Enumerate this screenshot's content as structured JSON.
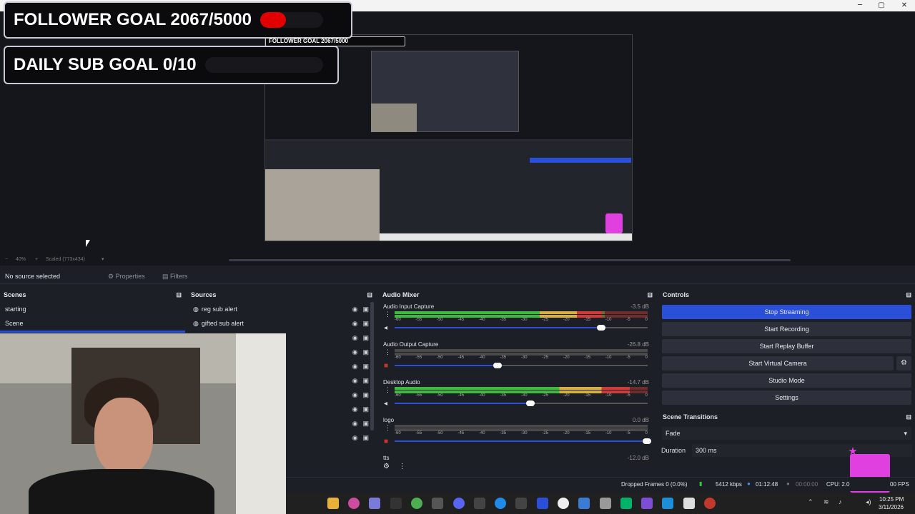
{
  "window": {
    "minimize": "─",
    "maximize": "▢",
    "close": "✕"
  },
  "overlay": {
    "follower_goal": "FOLLOWER GOAL 2067/5000",
    "follower_progress": 0.4134,
    "sub_goal": "DAILY SUB GOAL 0/10",
    "sub_progress": 0
  },
  "preview": {
    "zoom": "40%",
    "scale_label": "Scaled (773x434)"
  },
  "source_toolbar": {
    "no_source": "No source selected",
    "properties": "Properties",
    "filters": "Filters"
  },
  "scenes": {
    "title": "Scenes",
    "items": [
      "starting",
      "Scene"
    ]
  },
  "sources": {
    "title": "Sources",
    "items": [
      "reg sub alert",
      "gifted sub alert"
    ]
  },
  "mixer": {
    "title": "Audio Mixer",
    "ticks": [
      "-60",
      "-55",
      "-50",
      "-45",
      "-40",
      "-35",
      "-30",
      "-25",
      "-20",
      "-15",
      "-10",
      "-5",
      "0"
    ],
    "tracks": [
      {
        "name": "Audio Input Capture",
        "db": "-3.5 dB",
        "level": 0.82,
        "volume": 0.82,
        "muted": false
      },
      {
        "name": "Audio Output Capture",
        "db": "-26.8 dB",
        "level": 0,
        "volume": 0.41,
        "muted": true
      },
      {
        "name": "Desktop Audio",
        "db": "-14.7 dB",
        "level": 0.93,
        "volume": 0.54,
        "muted": false
      },
      {
        "name": "logo",
        "db": "0.0 dB",
        "level": 0,
        "volume": 1.0,
        "muted": true
      },
      {
        "name": "tts",
        "db": "-12.0 dB",
        "level": 0,
        "volume": 0.6,
        "muted": false
      }
    ]
  },
  "controls": {
    "title": "Controls",
    "stop_streaming": "Stop Streaming",
    "start_recording": "Start Recording",
    "start_replay": "Start Replay Buffer",
    "start_vcam": "Start Virtual Camera",
    "studio_mode": "Studio Mode",
    "settings": "Settings"
  },
  "transitions": {
    "title": "Scene Transitions",
    "selected": "Fade",
    "duration_label": "Duration",
    "duration_value": "300 ms"
  },
  "status": {
    "dropped": "Dropped Frames 0 (0.0%)",
    "bitrate": "5412 kbps",
    "stream_time": "01:12:48",
    "rec_time": "00:00:00",
    "cpu": "CPU: 2.0",
    "fps": "00 FPS"
  },
  "clock": {
    "time": "10:25 PM",
    "date": "3/11/2026"
  },
  "colors": {
    "accent": "#2a4fd8",
    "brand": "#e040e0",
    "goal_red": "#e00000"
  }
}
